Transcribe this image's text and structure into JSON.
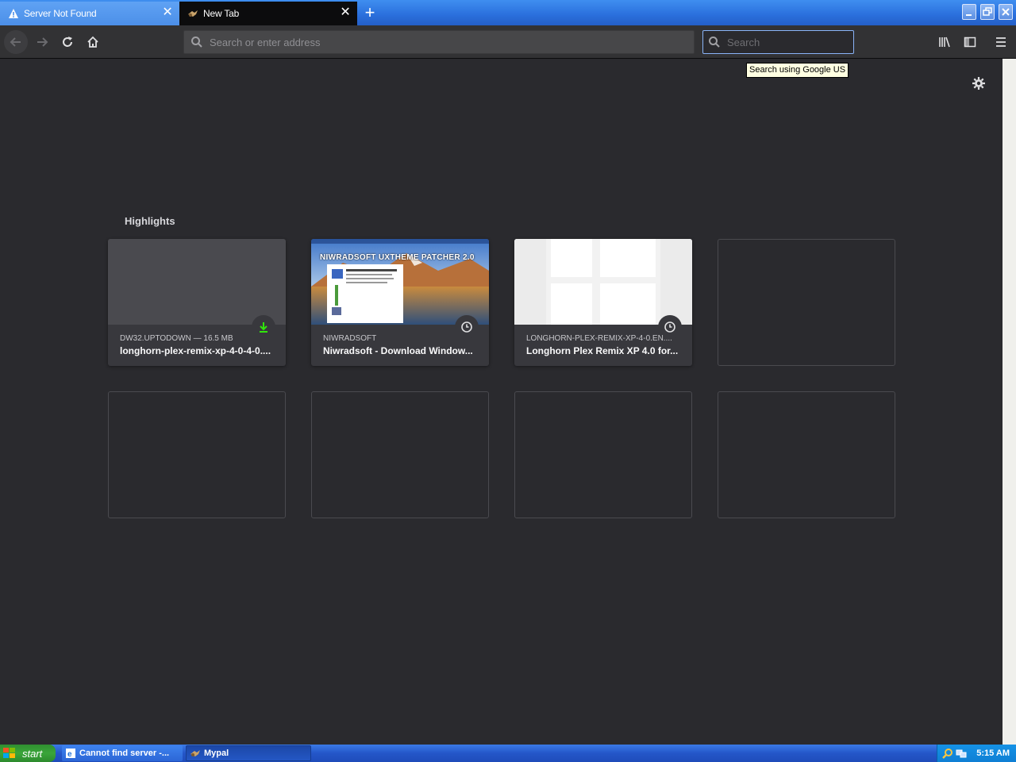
{
  "tabs": [
    {
      "title": "Server Not Found",
      "icon": "warning-icon",
      "active": false
    },
    {
      "title": "New Tab",
      "icon": "mypal-icon",
      "active": true
    }
  ],
  "toolbar": {
    "url_placeholder": "Search or enter address",
    "search_placeholder": "Search",
    "search_tooltip": "Search using Google US"
  },
  "highlights": {
    "title": "Highlights",
    "cards": [
      {
        "context": "DW32.UPTODOWN — 16.5 MB",
        "title": "longhorn-plex-remix-xp-4-0-4-0....",
        "badge_icon": "download-icon",
        "thumb": "gray"
      },
      {
        "context": "NIWRADSOFT",
        "title": "Niwradsoft - Download Window...",
        "badge_icon": "clock-icon",
        "thumb": "niwradsoft",
        "thumb_text": "NIWRADSOFT UXTHEME PATCHER 2.0"
      },
      {
        "context": "LONGHORN-PLEX-REMIX-XP-4-0.EN....",
        "title": "Longhorn Plex Remix XP 4.0 for...",
        "badge_icon": "clock-icon",
        "thumb": "windows-logo"
      }
    ],
    "empty_slots": 5
  },
  "taskbar": {
    "start_label": "start",
    "items": [
      {
        "label": "Cannot find server -...",
        "icon": "ie-icon"
      },
      {
        "label": "Mypal",
        "icon": "mypal-icon"
      }
    ],
    "clock": "5:15 AM"
  },
  "colors": {
    "background": "#2a2a2e",
    "toolbar": "#323234",
    "card": "#38383d",
    "download_green": "#30e60b",
    "xp_blue": "#245fc8"
  }
}
